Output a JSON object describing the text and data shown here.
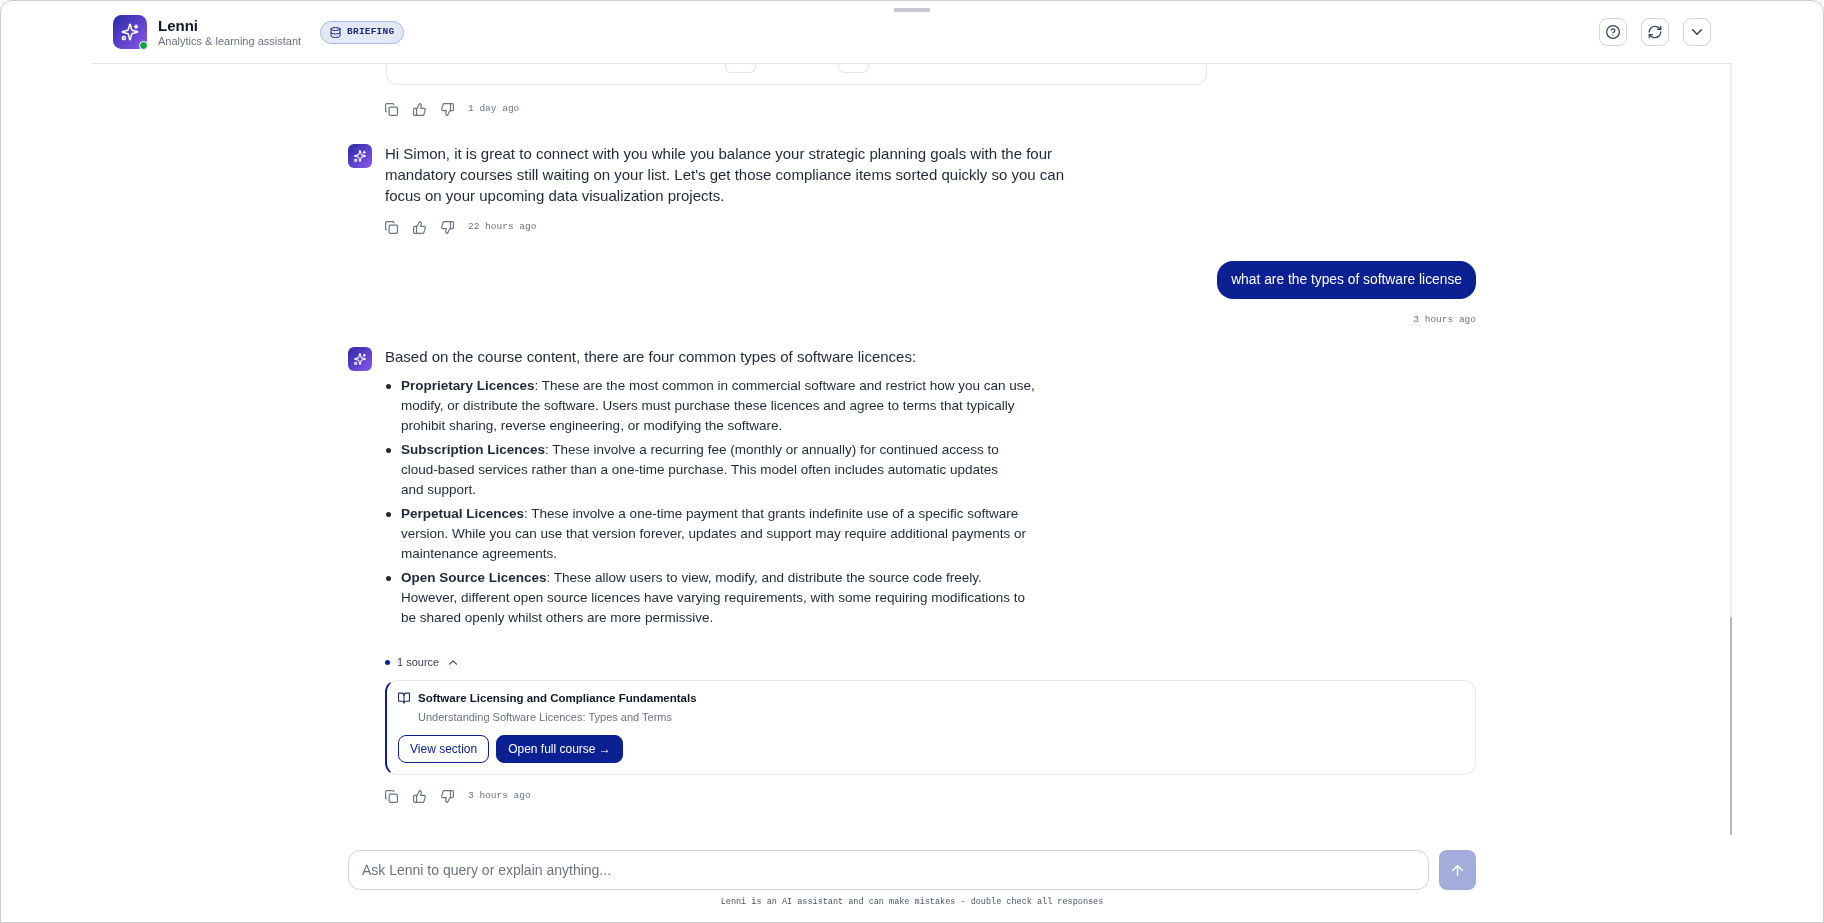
{
  "header": {
    "title": "Lenni",
    "subtitle": "Analytics & learning assistant",
    "online": true,
    "badge": "BRIEFING"
  },
  "messages": [
    {
      "kind": "clipped",
      "time": "1 day ago"
    },
    {
      "kind": "reply",
      "paragraphs": [
        "Hi Simon, it is great to connect with you while you balance your strategic planning goals with the four mandatory courses still waiting on your list. Let's get those compliance items sorted quickly so you can focus on your upcoming data visualization projects."
      ],
      "time": "22 hours ago"
    },
    {
      "kind": "prompt",
      "text": "what are the types of software license",
      "time": "3 hours ago"
    },
    {
      "kind": "reply",
      "paragraphs": [
        "Based on the course content, there are four common types of software licences:"
      ],
      "bullets": [
        "**Proprietary Licences**: These are the most common in commercial software and restrict how you can use, modify, or distribute the software. Users must purchase these licences and agree to terms that typically prohibit sharing, reverse engineering, or modifying the software.",
        "**Subscription Licences**: These involve a recurring fee (monthly or annually) for continued access to cloud-based services rather than a one-time purchase. This model often includes automatic updates and support.",
        "**Perpetual Licences**: These involve a one-time payment that grants indefinite use of a specific software version. While you can use that version forever, updates and support may require additional payments or maintenance agreements.",
        "**Open Source Licences**: These allow users to view, modify, and distribute the source code freely. However, different open source licences have varying requirements, with some requiring modifications to be shared openly whilst others are more permissive."
      ],
      "sources": {
        "label": "1 source",
        "expanded": true,
        "items": [
          {
            "title": "Software Licensing and Compliance Fundamentals",
            "subtitle": "Understanding Software Licences: Types and Terms",
            "buttons": [
              {
                "label": "View section",
                "kind": "outline"
              },
              {
                "label": "Open full course →",
                "kind": "primary"
              }
            ]
          }
        ]
      },
      "time": "3 hours ago"
    }
  ],
  "composer": {
    "placeholder": "Ask Lenni to query or explain anything...",
    "send_disabled": true
  },
  "disclaimer": "Lenni is an AI assistant and can make mistakes - double check all responses"
}
